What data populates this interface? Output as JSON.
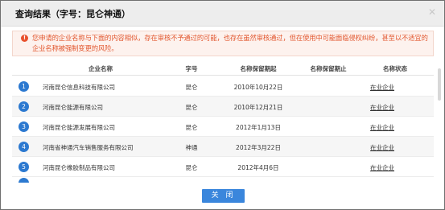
{
  "dialog": {
    "title": "查询结果（字号：昆仑神通）",
    "close_icon": "close-icon"
  },
  "warning": {
    "icon": "exclamation-icon",
    "text": "您申请的企业名称与下面的内容相似，存在审核不予通过的可能，也存在虽然审核通过，但在使用中可能面临侵权纠纷，甚至以不适宜的企业名称被强制变更的风险。"
  },
  "table": {
    "headers": [
      "企业名称",
      "字号",
      "名称保留期起",
      "名称保留期止",
      "名称状态"
    ],
    "rows": [
      {
        "num": "1",
        "name": "河南昆仑信息科技有限公司",
        "zihao": "昆仑",
        "start": "2010年10月22日",
        "end": "",
        "status": "在业企业"
      },
      {
        "num": "2",
        "name": "河南昆仑能源有限公司",
        "zihao": "昆仑",
        "start": "2010年12月21日",
        "end": "",
        "status": "在业企业"
      },
      {
        "num": "3",
        "name": "河南昆仑能源发展有限公司",
        "zihao": "昆仑",
        "start": "2012年1月13日",
        "end": "",
        "status": "在业企业"
      },
      {
        "num": "4",
        "name": "河南省神通汽车销售服务有限公司",
        "zihao": "神通",
        "start": "2012年3月22日",
        "end": "",
        "status": "在业企业"
      },
      {
        "num": "5",
        "name": "河南昆仑橡胶制品有限公司",
        "zihao": "昆仑",
        "start": "2012年4月6日",
        "end": "",
        "status": "在业企业"
      }
    ]
  },
  "footer": {
    "close_label": "关 闭"
  },
  "colors": {
    "accent": "#2c79d0",
    "warning": "#e2572f"
  }
}
